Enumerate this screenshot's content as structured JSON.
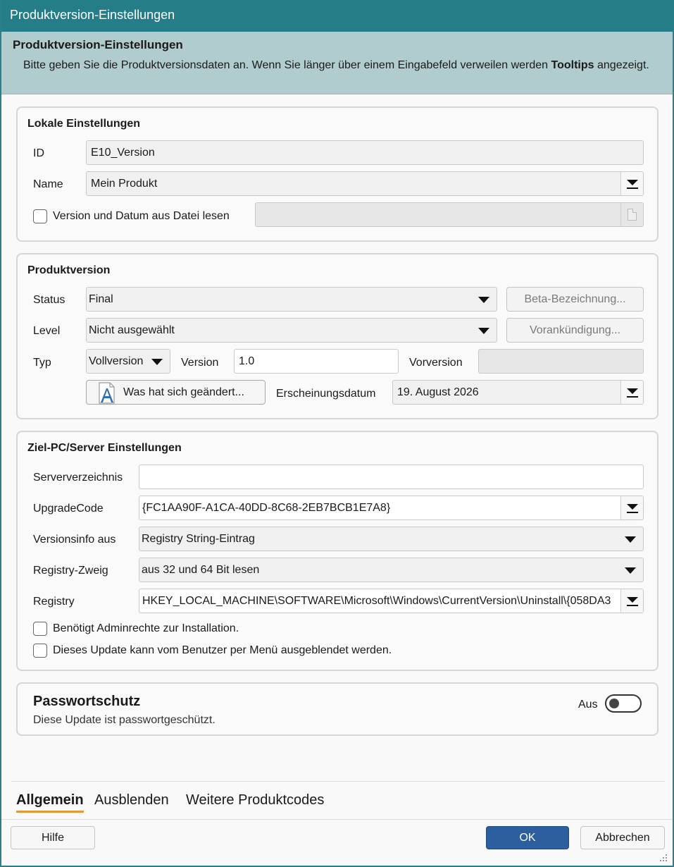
{
  "window": {
    "title": "Produktversion-Einstellungen"
  },
  "header": {
    "title": "Produktversion-Einstellungen",
    "desc_before": "Bitte geben Sie die Produktversionsdaten an. Wenn Sie länger über einem Eingabefeld verweilen werden ",
    "desc_bold": "Tooltips",
    "desc_after": " angezeigt."
  },
  "local": {
    "title": "Lokale Einstellungen",
    "id_label": "ID",
    "id_value": "E10_Version",
    "name_label": "Name",
    "name_value": "Mein Produkt",
    "read_file_label": "Version und Datum aus Datei lesen",
    "read_file_value": ""
  },
  "product": {
    "title": "Produktversion",
    "status_label": "Status",
    "status_value": "Final",
    "beta_button": "Beta-Bezeichnung...",
    "level_label": "Level",
    "level_value": "Nicht ausgewählt",
    "announce_button": "Vorankündigung...",
    "type_label": "Typ",
    "type_value": "Vollversion",
    "version_label": "Version",
    "version_value": "1.0",
    "prev_version_label": "Vorversion",
    "prev_version_value": "",
    "changes_button": "Was hat sich geändert...",
    "release_date_label": "Erscheinungsdatum",
    "release_date_value": "19. August 2026"
  },
  "target": {
    "title": "Ziel-PC/Server Einstellungen",
    "server_dir_label": "Serververzeichnis",
    "server_dir_value": "",
    "upgrade_code_label": "UpgradeCode",
    "upgrade_code_value": "{FC1AA90F-A1CA-40DD-8C68-2EB7BCB1E7A8}",
    "version_info_label": "Versionsinfo aus",
    "version_info_value": "Registry String-Eintrag",
    "registry_branch_label": "Registry-Zweig",
    "registry_branch_value": "aus 32 und 64 Bit lesen",
    "registry_label": "Registry",
    "registry_value": "HKEY_LOCAL_MACHINE\\SOFTWARE\\Microsoft\\Windows\\CurrentVersion\\Uninstall\\{058DA3",
    "admin_label": "Benötigt Adminrechte zur Installation.",
    "hide_label": "Dieses Update kann vom Benutzer per Menü ausgeblendet werden."
  },
  "password": {
    "title": "Passwortschutz",
    "desc": "Diese Update ist passwortgeschützt.",
    "toggle_label": "Aus"
  },
  "tabs": [
    {
      "label": "Allgemein"
    },
    {
      "label": "Ausblenden"
    },
    {
      "label": "Weitere Produktcodes"
    }
  ],
  "footer": {
    "help": "Hilfe",
    "ok": "OK",
    "cancel": "Abbrechen"
  }
}
